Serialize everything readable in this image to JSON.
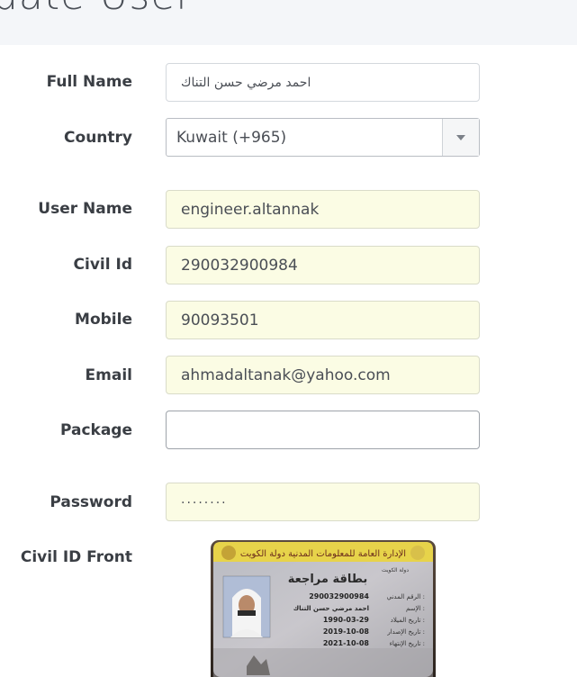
{
  "header": {
    "title": "date User"
  },
  "form": {
    "full_name": {
      "label": "Full Name",
      "value": "احمد مرضي حسن التناك"
    },
    "country": {
      "label": "Country",
      "value": "Kuwait (+965)"
    },
    "user_name": {
      "label": "User Name",
      "value": "engineer.altannak"
    },
    "civil_id": {
      "label": "Civil Id",
      "value": "290032900984"
    },
    "mobile": {
      "label": "Mobile",
      "value": "90093501"
    },
    "email": {
      "label": "Email",
      "value": "ahmadaltanak@yahoo.com"
    },
    "package": {
      "label": "Package",
      "value": ""
    },
    "password": {
      "label": "Password",
      "value": "········"
    },
    "civil_id_front": {
      "label": "Civil ID Front"
    }
  },
  "civil_card": {
    "header_text": "الإدارة العامة للمعلومات المدنية دولة الكويت",
    "card_title": "بطاقة مراجعة",
    "state": "دولة الكويت",
    "rows": [
      {
        "label": "الرقم المدني :",
        "value": "290032900984"
      },
      {
        "label": "الإسم :",
        "value": "احمد مرضي حسن التناك"
      },
      {
        "label": "تاريخ الميلاد :",
        "value": "1990-03-29"
      },
      {
        "label": "تاريخ الإصدار :",
        "value": "2019-10-08"
      },
      {
        "label": "تاريخ الإنتهاء :",
        "value": "2021-10-08"
      }
    ]
  }
}
